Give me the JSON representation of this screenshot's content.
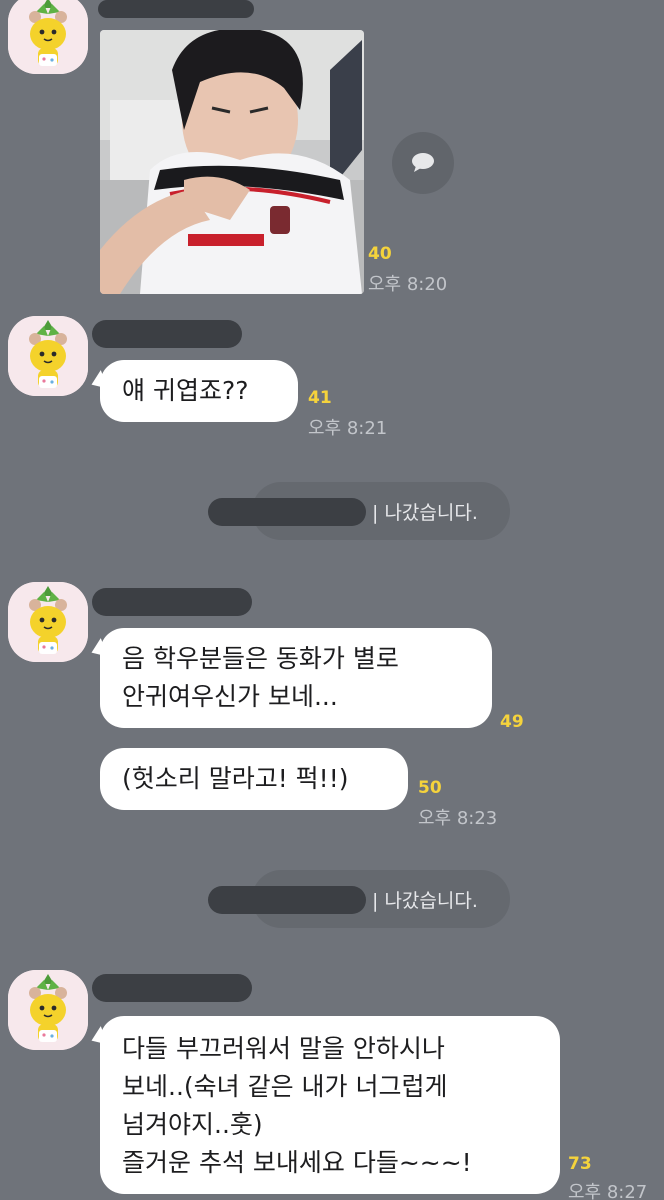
{
  "chat": {
    "messages": [
      {
        "type": "photo",
        "unread": "40",
        "time": "오후 8:20"
      },
      {
        "type": "text",
        "text": "얘 귀엽죠??",
        "unread": "41",
        "time": "오후 8:21"
      },
      {
        "type": "system",
        "text": "| 나갔습니다."
      },
      {
        "type": "text",
        "text": "음 학우분들은 동화가 별로\n안귀여우신가 보네...",
        "unread": "49"
      },
      {
        "type": "text",
        "text": "(헛소리 말라고! 퍽!!)",
        "unread": "50",
        "time": "오후 8:23"
      },
      {
        "type": "system",
        "text": "| 나갔습니다."
      },
      {
        "type": "text",
        "text": "다들 부끄러워서 말을 안하시나\n보네..(숙녀 같은 내가 너그럽게\n넘겨야지..훗)\n즐거운 추석 보내세요 다들~~~!",
        "unread": "73",
        "time": "오후 8:27"
      }
    ]
  },
  "icons": {
    "avatar": "pineapple-character-avatar-icon",
    "share": "speech-bubble-icon"
  },
  "colors": {
    "background": "#6f737a",
    "bubble": "#ffffff",
    "unread": "#f5d33c",
    "redaction": "#3c3f44"
  }
}
